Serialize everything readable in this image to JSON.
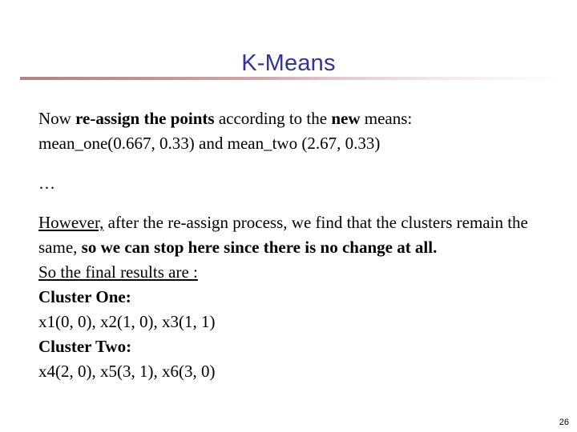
{
  "slide": {
    "title": "K-Means",
    "title_color": "#333399",
    "rule_color_start": "#b08484",
    "rule_color_end": "#fdfbfd",
    "background_color": "#ffffff",
    "page_number": "26"
  },
  "body": {
    "line1": {
      "seg1": "Now ",
      "seg2_bold": "re-assign the points",
      "seg3": " according to the ",
      "seg4_bold": "new",
      "seg5": " means:"
    },
    "line2": "mean_one(0.667, 0.33) and mean_two (2.67, 0.33)",
    "line3_ellipsis": "…",
    "line4": {
      "seg1_underline": "However,",
      "seg2": " after the re-assign process, we find that the clusters remain the same, ",
      "seg3_bold": "so we can stop here since there is no change at all."
    },
    "line5_underline": "So the final results are :",
    "line6_bold": "Cluster One:",
    "line7": "x1(0, 0), x2(1, 0), x3(1, 1)",
    "line8_bold": "Cluster Two:",
    "line9": "x4(2, 0), x5(3, 1), x6(3, 0)"
  }
}
